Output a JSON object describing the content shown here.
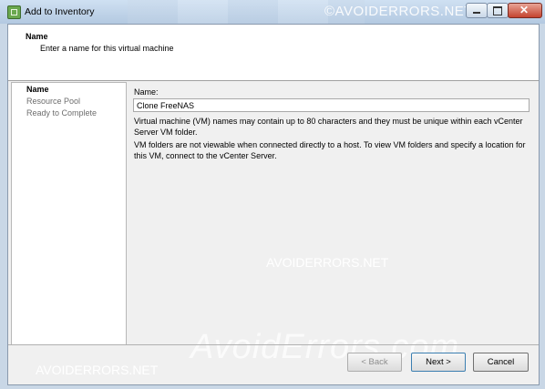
{
  "window": {
    "title": "Add to Inventory",
    "watermark_top": "©AVOIDERRORS.NET",
    "controls": {
      "minimize_icon": "minimize-icon",
      "maximize_icon": "maximize-icon",
      "close_icon": "close-icon"
    }
  },
  "header": {
    "title": "Name",
    "subtitle": "Enter a name for this virtual machine"
  },
  "steps": [
    {
      "label": "Name",
      "active": true
    },
    {
      "label": "Resource Pool",
      "active": false
    },
    {
      "label": "Ready to Complete",
      "active": false
    }
  ],
  "form": {
    "name_label": "Name:",
    "name_value": "Clone FreeNAS",
    "info1": "Virtual machine (VM) names may contain up to 80 characters and they must be unique within each vCenter Server VM folder.",
    "info2": "VM folders are not viewable when connected directly to a host. To view VM folders and specify a location for this VM, connect to the vCenter Server."
  },
  "watermarks": {
    "middle": "AVOIDERRORS.NET",
    "big": "AvoidErrors.com",
    "bottom": "AVOIDERRORS.NET"
  },
  "buttons": {
    "back": "< Back",
    "next": "Next >",
    "cancel": "Cancel"
  }
}
